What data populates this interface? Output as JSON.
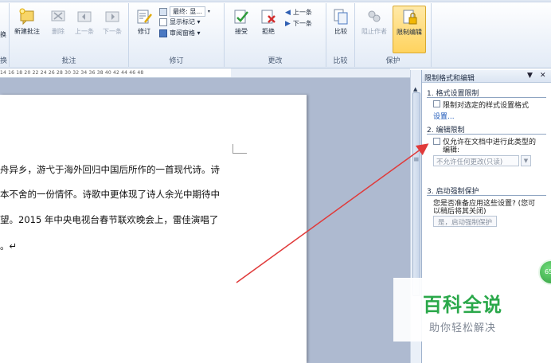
{
  "ribbon": {
    "groups": {
      "comments_label": "批注",
      "tracking_label": "修订",
      "changes_label": "更改",
      "compare_label": "比较",
      "protect_label": "保护",
      "left_partial_label": "换"
    },
    "left_partial_button": "换",
    "buttons": {
      "new_comment": "新建批注",
      "delete": "删除",
      "prev": "上一条",
      "next": "下一条",
      "track_changes": "修订",
      "final_display": "最终: 显...",
      "show_markup": "显示标记 ▾",
      "review_pane": "审阅窗格 ▾",
      "accept": "接受",
      "reject": "拒绝",
      "prev_change": "上一条",
      "next_change": "下一条",
      "compare": "比较",
      "block_authors": "阻止作者",
      "restrict_editing": "限制编辑"
    }
  },
  "ruler": {
    "numbers": "14   16   18   20   22   24   26   28   30   32   34   36   38  40   42   44   46   48"
  },
  "document": {
    "lines": [
      "舟异乡，游弋于海外回归中国后所作的一首现代诗。诗",
      "本不舍的一份情怀。诗歌中更体现了诗人余光中期待中",
      "望。2015 年中央电视台春节联欢晚会上，雷佳演唱了",
      "。↵"
    ]
  },
  "pane": {
    "title": "限制格式和编辑",
    "section1": {
      "title": "1.  格式设置限制",
      "checkbox_label": "限制对选定的样式设置格式",
      "settings_link": "设置..."
    },
    "section2": {
      "title": "2.  编辑限制",
      "checkbox_label_line1": "仅允许在文档中进行此类型的",
      "checkbox_label_line2": "编辑:",
      "dropdown_value": "不允许任何更改(只读)"
    },
    "section3": {
      "title": "3.  启动强制保护",
      "question_line1": "您是否准备应用这些设置? (您可",
      "question_line2": "以稍后将其关闭)",
      "start_button": "是，启动强制保护"
    }
  },
  "watermark": {
    "title": "百科全说",
    "subtitle": "助你轻松解决"
  },
  "badge": {
    "text": "65"
  },
  "colors": {
    "accent_arrow": "#e03a3a",
    "watermark_green": "#2aa84a",
    "ribbon_bg": "#e3ebf6"
  }
}
